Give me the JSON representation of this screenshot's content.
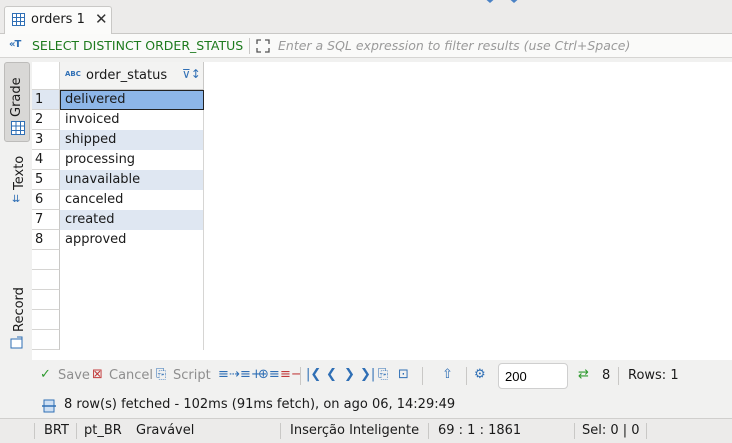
{
  "editor_tab": {
    "title": "orders 1",
    "icon": "table-grid-icon",
    "close_icon": "close-icon"
  },
  "filter_bar": {
    "sql_icon": "T",
    "sql_text": "SELECT DISTINCT ORDER_STATUS",
    "placeholder": "Enter a SQL expression to filter results (use Ctrl+Space)"
  },
  "side_tabs": {
    "grade": "Grade",
    "texto": "Texto",
    "record": "Record"
  },
  "grid": {
    "column": {
      "type_badge": "ABC",
      "label": "order_status",
      "sort_icon": "filter-sort-icon"
    },
    "rows": [
      {
        "num": "1",
        "value": "delivered"
      },
      {
        "num": "2",
        "value": "invoiced"
      },
      {
        "num": "3",
        "value": "shipped"
      },
      {
        "num": "4",
        "value": "processing"
      },
      {
        "num": "5",
        "value": "unavailable"
      },
      {
        "num": "6",
        "value": "canceled"
      },
      {
        "num": "7",
        "value": "created"
      },
      {
        "num": "8",
        "value": "approved"
      }
    ],
    "selected_row": 1
  },
  "toolbar": {
    "save_label": "Save",
    "cancel_label": "Cancel",
    "script_label": "Script",
    "fetch_size": "200",
    "fetched_count": "8",
    "rows_label": "Rows: 1"
  },
  "info": {
    "message": "8 row(s) fetched - 102ms (91ms fetch), on ago 06, 14:29:49"
  },
  "status_bar": {
    "timezone": "BRT",
    "locale": "pt_BR",
    "mode": "Gravável",
    "insert_mode": "Inserção Inteligente",
    "position": "69 : 1 : 1861",
    "selection": "Sel: 0 | 0"
  },
  "colors": {
    "accent": "#2f6fb5",
    "selection": "#8db6e8",
    "alt_row": "#dfe7f2",
    "sql_green": "#1d7a1d"
  }
}
